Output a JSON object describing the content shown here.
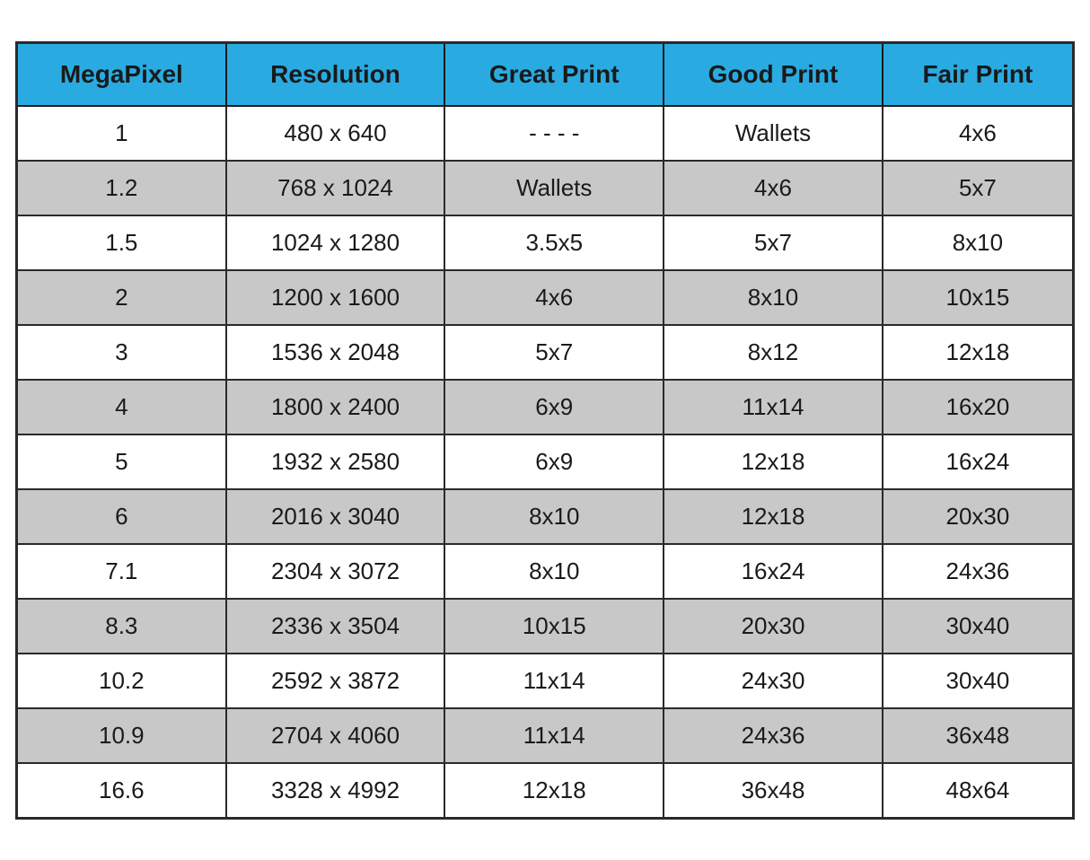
{
  "table": {
    "headers": [
      "MegaPixel",
      "Resolution",
      "Great Print",
      "Good Print",
      "Fair Print"
    ],
    "rows": [
      {
        "megapixel": "1",
        "resolution": "480 x 640",
        "great": "- - - -",
        "good": "Wallets",
        "fair": "4x6"
      },
      {
        "megapixel": "1.2",
        "resolution": "768 x 1024",
        "great": "Wallets",
        "good": "4x6",
        "fair": "5x7"
      },
      {
        "megapixel": "1.5",
        "resolution": "1024 x 1280",
        "great": "3.5x5",
        "good": "5x7",
        "fair": "8x10"
      },
      {
        "megapixel": "2",
        "resolution": "1200 x 1600",
        "great": "4x6",
        "good": "8x10",
        "fair": "10x15"
      },
      {
        "megapixel": "3",
        "resolution": "1536 x 2048",
        "great": "5x7",
        "good": "8x12",
        "fair": "12x18"
      },
      {
        "megapixel": "4",
        "resolution": "1800 x 2400",
        "great": "6x9",
        "good": "11x14",
        "fair": "16x20"
      },
      {
        "megapixel": "5",
        "resolution": "1932 x 2580",
        "great": "6x9",
        "good": "12x18",
        "fair": "16x24"
      },
      {
        "megapixel": "6",
        "resolution": "2016 x 3040",
        "great": "8x10",
        "good": "12x18",
        "fair": "20x30"
      },
      {
        "megapixel": "7.1",
        "resolution": "2304 x 3072",
        "great": "8x10",
        "good": "16x24",
        "fair": "24x36"
      },
      {
        "megapixel": "8.3",
        "resolution": "2336 x 3504",
        "great": "10x15",
        "good": "20x30",
        "fair": "30x40"
      },
      {
        "megapixel": "10.2",
        "resolution": "2592 x 3872",
        "great": "11x14",
        "good": "24x30",
        "fair": "30x40"
      },
      {
        "megapixel": "10.9",
        "resolution": "2704 x 4060",
        "great": "11x14",
        "good": "24x36",
        "fair": "36x48"
      },
      {
        "megapixel": "16.6",
        "resolution": "3328 x 4992",
        "great": "12x18",
        "good": "36x48",
        "fair": "48x64"
      }
    ]
  }
}
